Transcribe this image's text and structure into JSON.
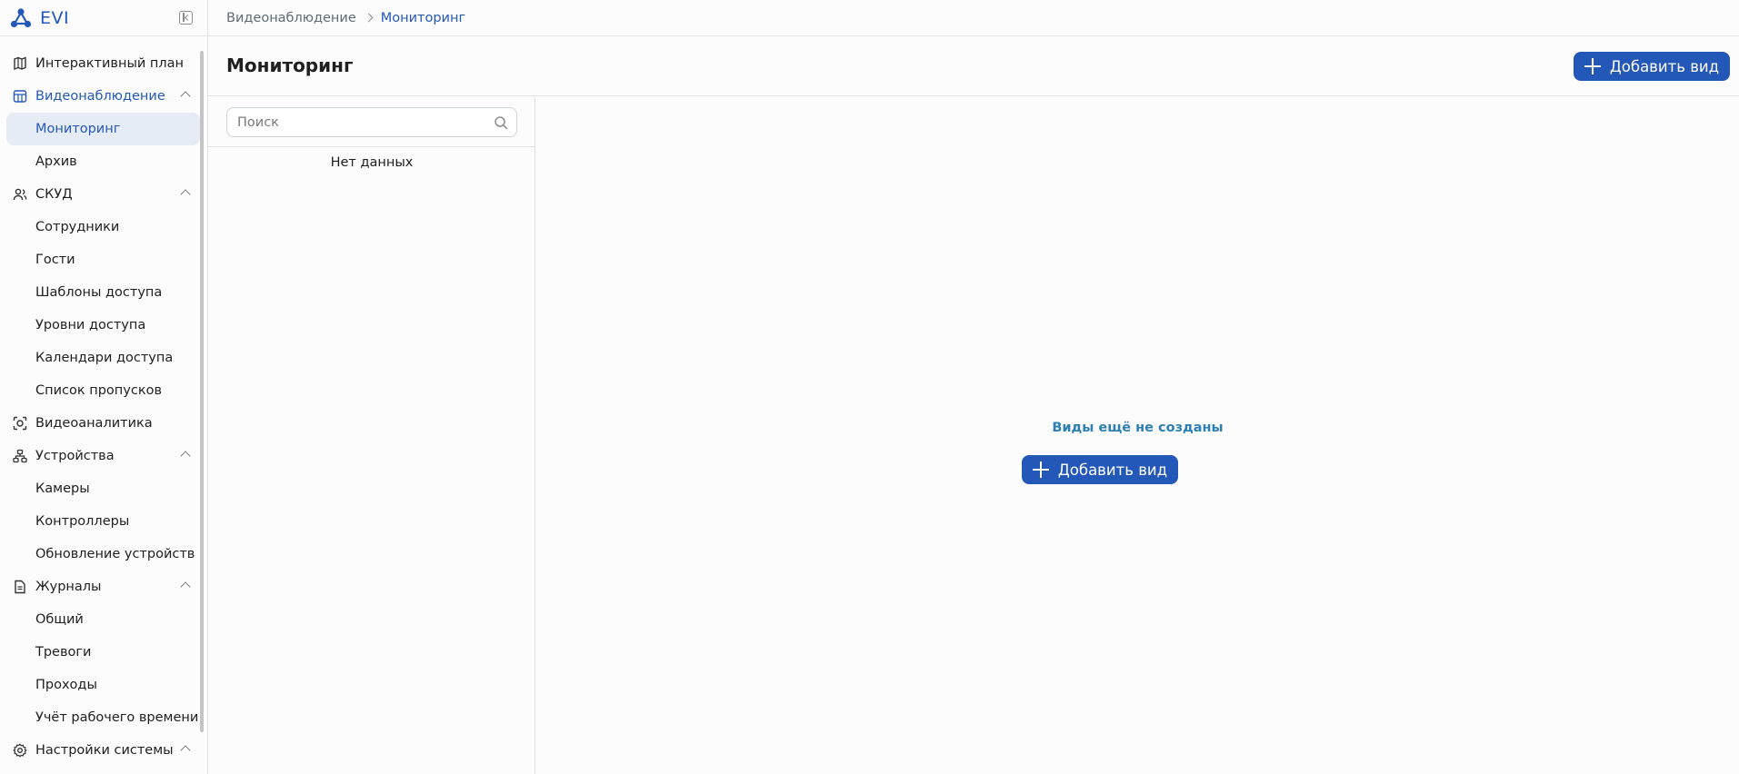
{
  "app": {
    "name": "EVI"
  },
  "breadcrumb": [
    "Видеонаблюдение",
    "Мониторинг"
  ],
  "page": {
    "title": "Мониторинг",
    "add_button": "Добавить вид"
  },
  "search": {
    "placeholder": "Поиск",
    "value": ""
  },
  "list": {
    "empty_text": "Нет данных"
  },
  "empty_state": {
    "message": "Виды ещё не созданы",
    "button": "Добавить вид"
  },
  "colors": {
    "accent": "#2458b8",
    "selected_bg": "#e6ecf6",
    "empty_text": "#2e7fb3"
  },
  "nav": [
    {
      "label": "Интерактивный план",
      "icon": "map-icon",
      "type": "group"
    },
    {
      "label": "Видеонаблюдение",
      "icon": "video-grid-icon",
      "type": "group",
      "expanded": true,
      "active": true
    },
    {
      "label": "Мониторинг",
      "type": "sub",
      "selected": true
    },
    {
      "label": "Архив",
      "type": "sub"
    },
    {
      "label": "СКУД",
      "icon": "users-icon",
      "type": "group",
      "expanded": true
    },
    {
      "label": "Сотрудники",
      "type": "sub"
    },
    {
      "label": "Гости",
      "type": "sub"
    },
    {
      "label": "Шаблоны доступа",
      "type": "sub"
    },
    {
      "label": "Уровни доступа",
      "type": "sub"
    },
    {
      "label": "Календари доступа",
      "type": "sub"
    },
    {
      "label": "Список пропусков",
      "type": "sub"
    },
    {
      "label": "Видеоаналитика",
      "icon": "camera-focus-icon",
      "type": "group"
    },
    {
      "label": "Устройства",
      "icon": "devices-icon",
      "type": "group",
      "expanded": true
    },
    {
      "label": "Камеры",
      "type": "sub"
    },
    {
      "label": "Контроллеры",
      "type": "sub"
    },
    {
      "label": "Обновление устройств",
      "type": "sub"
    },
    {
      "label": "Журналы",
      "icon": "document-icon",
      "type": "group",
      "expanded": true
    },
    {
      "label": "Общий",
      "type": "sub"
    },
    {
      "label": "Тревоги",
      "type": "sub"
    },
    {
      "label": "Проходы",
      "type": "sub"
    },
    {
      "label": "Учёт рабочего времени",
      "type": "sub"
    },
    {
      "label": "Настройки системы",
      "icon": "gear-icon",
      "type": "group",
      "expanded": true
    }
  ]
}
